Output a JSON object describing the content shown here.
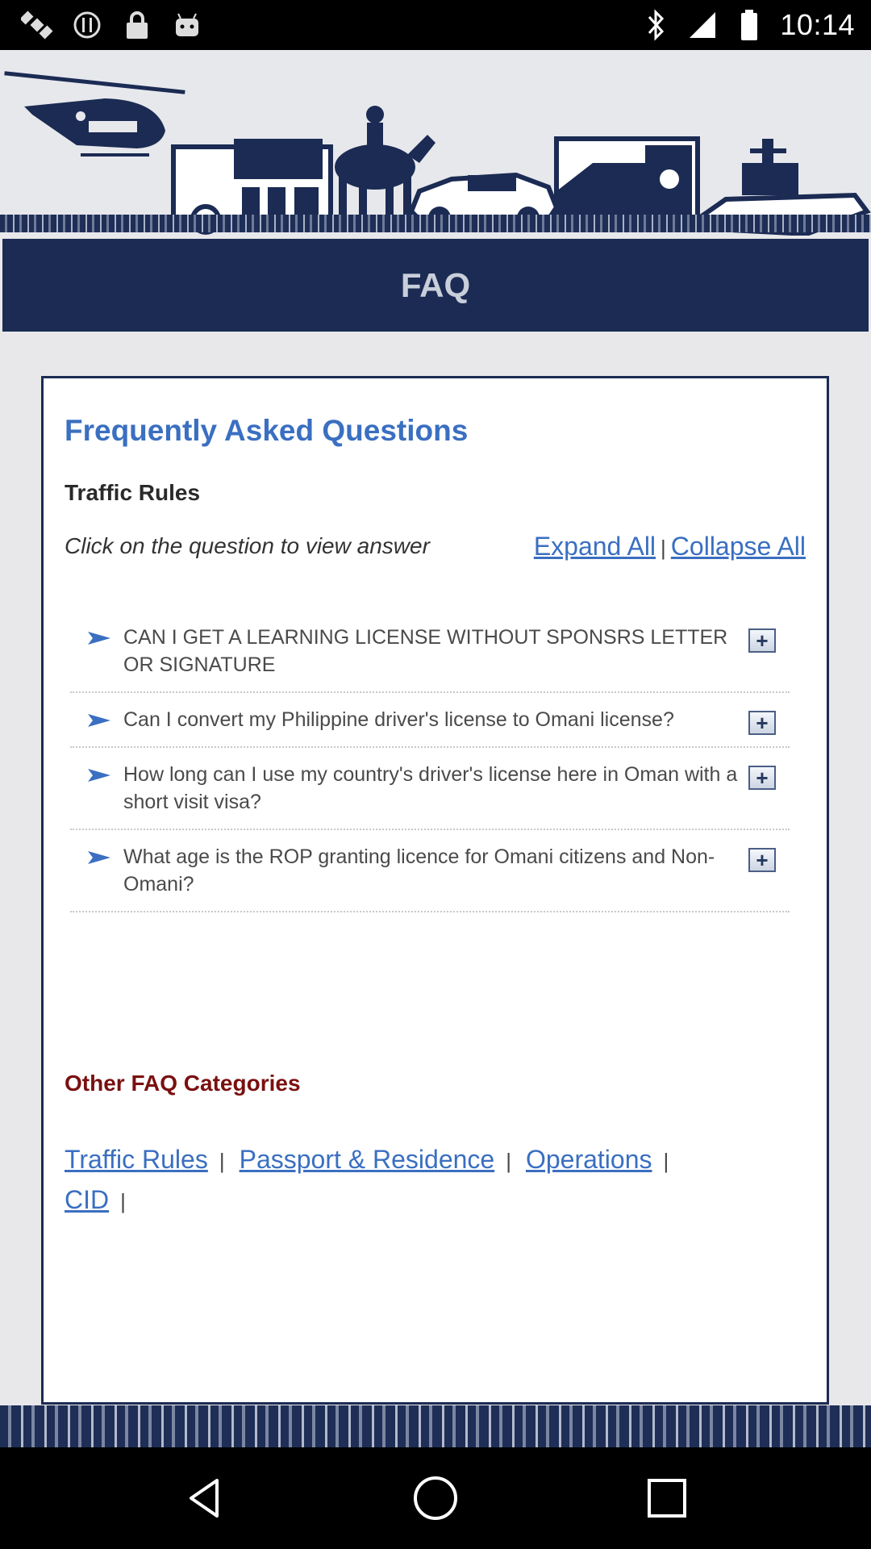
{
  "status_bar": {
    "time": "10:14",
    "left_icons": [
      "satellite-icon",
      "sync-icon",
      "lock-icon",
      "android-icon"
    ],
    "right_icons": [
      "bluetooth-icon",
      "signal-icon",
      "battery-icon"
    ]
  },
  "header": {
    "banner_icons": [
      "helicopter-icon",
      "fire-truck-icon",
      "horse-rider-icon",
      "police-car-icon",
      "ambulance-icon",
      "patrol-boat-icon"
    ],
    "title": "FAQ"
  },
  "content": {
    "heading": "Frequently Asked Questions",
    "category": "Traffic Rules",
    "hint": "Click on the question to view answer",
    "expand_all": "Expand All",
    "separator": "|",
    "collapse_all": "Collapse All",
    "questions": [
      {
        "text": "CAN I GET A LEARNING LICENSE WITHOUT SPONSRS LETTER OR SIGNATURE"
      },
      {
        "text": "Can I convert my Philippine driver's license to Omani license?"
      },
      {
        "text": "How long can I use my country's driver's license here in Oman with a short visit visa?"
      },
      {
        "text": "What age is the ROP granting licence for Omani citizens and Non-Omani?"
      }
    ],
    "toggle_symbol": "+",
    "other_title": "Other FAQ Categories",
    "other_categories": [
      "Traffic Rules",
      "Passport & Residence",
      "Operations",
      "CID"
    ]
  },
  "colors": {
    "navy": "#1b2b53",
    "link": "#3a6fc1",
    "other_title": "#7a1010"
  },
  "nav_bar": {
    "icons": [
      "back-icon",
      "home-icon",
      "recents-icon"
    ]
  }
}
